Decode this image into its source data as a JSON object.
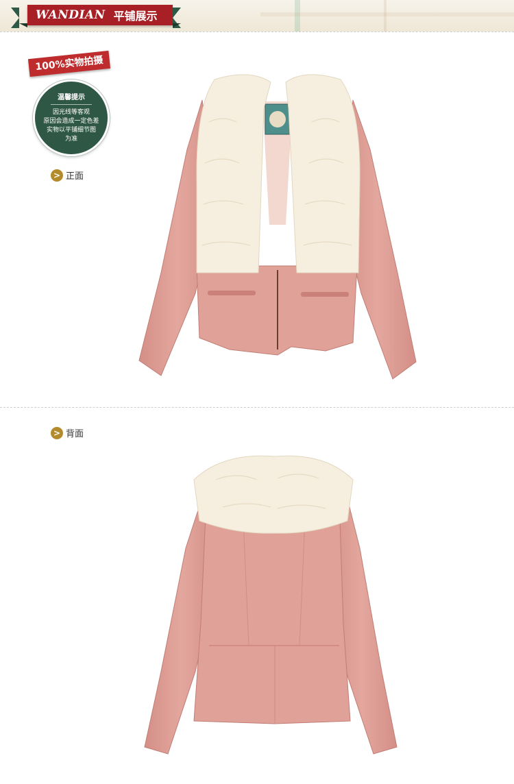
{
  "header": {
    "brand": "WANDIAN",
    "title": "平铺展示"
  },
  "sticker": {
    "tag": "100%实物拍摄",
    "tip_title": "温馨提示",
    "tip_lines": [
      "因光线等客观",
      "原因会造成一定色差",
      "实物以平铺细节图",
      "为准"
    ]
  },
  "views": {
    "front_label": "正面",
    "back_label": "背面"
  },
  "colors": {
    "banner_red": "#a82025",
    "banner_green": "#2d5a46",
    "tip_green": "#2f5745",
    "arrow_gold": "#b48b2a",
    "coat_pink": "#dc9c94",
    "fur_cream": "#f6efe0"
  }
}
